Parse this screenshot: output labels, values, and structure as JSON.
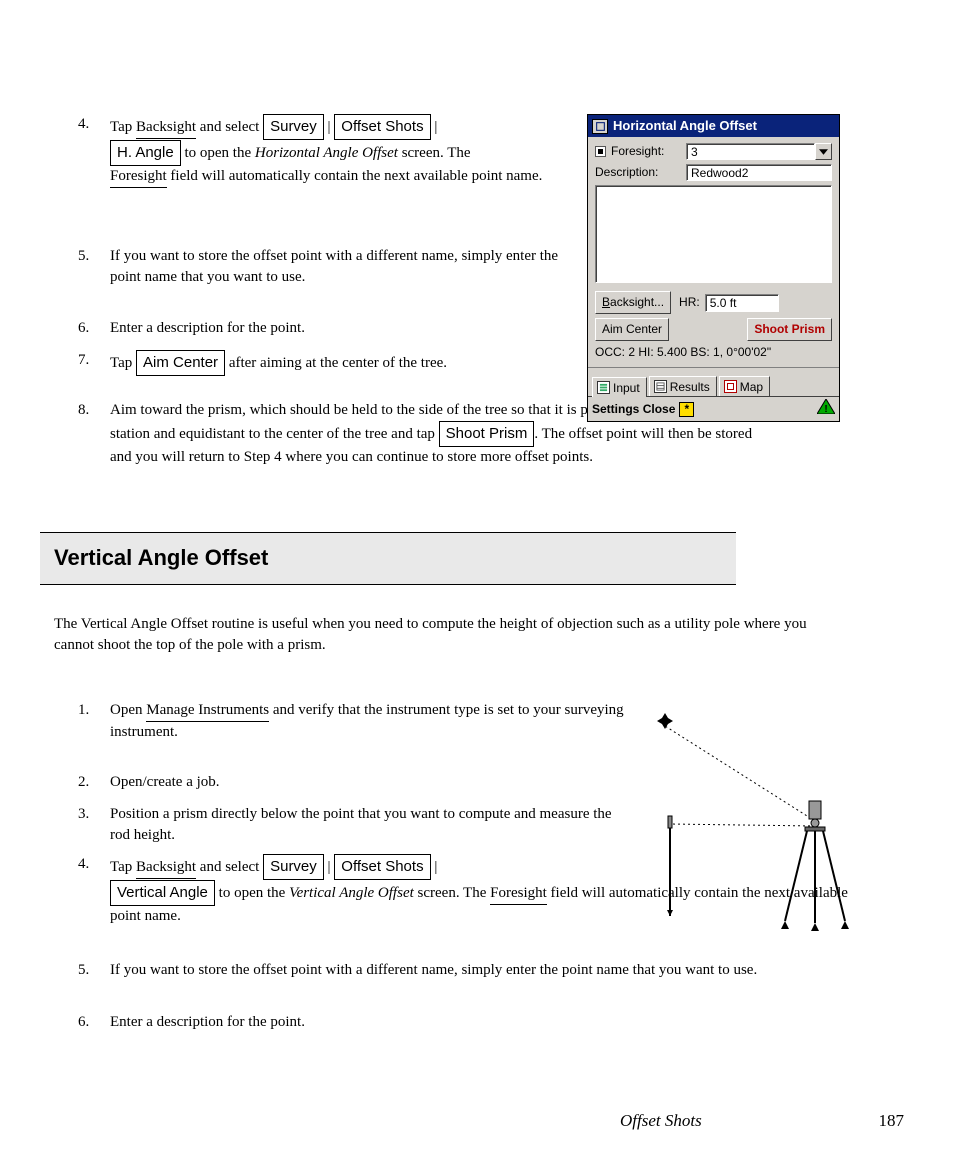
{
  "steps_first": [
    {
      "num": "4.",
      "parts": [
        {
          "t": "Tap ",
          "k": "plain"
        },
        {
          "t": "Backsight",
          "k": "under"
        },
        {
          "t": " and select ",
          "k": "plain"
        },
        {
          "t": "Survey",
          "k": "box"
        },
        {
          "t": " | ",
          "k": "plain"
        },
        {
          "t": "Offset Shots",
          "k": "box"
        },
        {
          "t": " | ",
          "k": "plain"
        },
        {
          "t": "H. Angle",
          "k": "box"
        },
        {
          "t": " to open the ",
          "k": "plain"
        },
        {
          "t": "Horizontal Angle Offset",
          "k": "ital"
        },
        {
          "t": " screen. The ",
          "k": "plain"
        },
        {
          "t": "Foresight",
          "k": "under"
        },
        {
          "t": " field will automatically contain the next available point name.",
          "k": "plain"
        }
      ]
    },
    {
      "num": "5.",
      "parts": [
        {
          "t": "If you want to store the offset point with a different name, simply enter the point name that you want to use.",
          "k": "plain"
        }
      ]
    },
    {
      "num": "6.",
      "parts": [
        {
          "t": "Enter a description for the point.",
          "k": "plain"
        }
      ]
    },
    {
      "num": "7.",
      "parts": [
        {
          "t": "Tap ",
          "k": "plain"
        },
        {
          "t": "Aim Center",
          "k": "box"
        },
        {
          "t": " after aiming at the center of the tree.",
          "k": "plain"
        }
      ]
    },
    {
      "num": "8.",
      "parts": [
        {
          "t": "Aim toward the prism, which should be held to the side of the tree so that it is perpendicular to the total station and equidistant to the center of the tree and tap ",
          "k": "plain"
        },
        {
          "t": "Shoot Prism",
          "k": "box"
        },
        {
          "t": ". The offset point will then be stored and you will return to Step 4 where you can continue to store more offset points.",
          "k": "plain"
        }
      ]
    }
  ],
  "section_title": "Vertical Angle Offset",
  "section_intro": "The Vertical Angle Offset routine is useful when you need to compute the height of objection such as a utility pole where you cannot shoot the top of the pole with a prism.",
  "steps_second": [
    {
      "num": "1.",
      "parts": [
        {
          "t": "Open ",
          "k": "plain"
        },
        {
          "t": "Manage Instruments",
          "k": "under"
        },
        {
          "t": " and verify that the instrument type is set to your surveying instrument.",
          "k": "plain"
        }
      ]
    },
    {
      "num": "2.",
      "parts": [
        {
          "t": "Open/create a job.",
          "k": "plain"
        }
      ]
    },
    {
      "num": "3.",
      "parts": [
        {
          "t": "Position a prism directly below the point that you want to compute and measure the rod height.",
          "k": "plain"
        }
      ]
    },
    {
      "num": "4.",
      "parts": [
        {
          "t": "Tap ",
          "k": "plain"
        },
        {
          "t": "Backsight",
          "k": "under"
        },
        {
          "t": " and select ",
          "k": "plain"
        },
        {
          "t": "Survey",
          "k": "box"
        },
        {
          "t": " | ",
          "k": "plain"
        },
        {
          "t": "Offset Shots",
          "k": "box"
        },
        {
          "t": " | ",
          "k": "plain"
        },
        {
          "t": "Vertical Angle",
          "k": "box"
        },
        {
          "t": " to open the ",
          "k": "plain"
        },
        {
          "t": "Vertical Angle Offset",
          "k": "ital"
        },
        {
          "t": " screen. The ",
          "k": "plain"
        },
        {
          "t": "Foresight",
          "k": "under"
        },
        {
          "t": " field will automatically contain the next available point name.",
          "k": "plain"
        }
      ]
    },
    {
      "num": "5.",
      "parts": [
        {
          "t": "If you want to store the offset point with a different name, simply enter the point name that you want to use.",
          "k": "plain"
        }
      ]
    },
    {
      "num": "6.",
      "parts": [
        {
          "t": "Enter a description for the point.",
          "k": "plain"
        }
      ]
    }
  ],
  "app": {
    "title": "Horizontal Angle Offset",
    "foresight_label": "Foresight:",
    "foresight_value": "3",
    "desc_label": "Description:",
    "desc_value": "Redwood2",
    "backsight_btn": "Backsight...",
    "hr_label": "HR:",
    "hr_value": "5.0 ft",
    "aim_btn": "Aim Center",
    "shoot_btn": "Shoot Prism",
    "status": "OCC: 2  HI: 5.400  BS: 1, 0°00'02\"",
    "tabs": [
      "Input",
      "Results",
      "Map"
    ],
    "settings": "Settings",
    "close": "Close",
    "star": "*"
  },
  "page_footer_left": "Offset Shots",
  "page_footer_right": "187"
}
